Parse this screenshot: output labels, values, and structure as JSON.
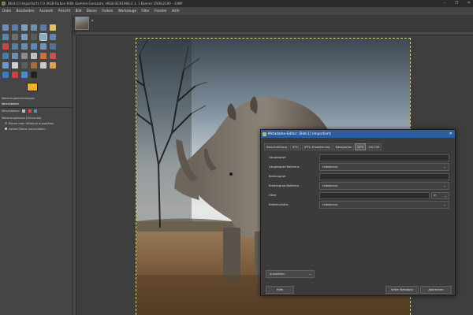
{
  "window": {
    "title": "[Bild-1] (importiert)-7.0 (RGB-Farben 8-Bit Gamma-Ganzzahl, sRGB IEC61966-2.1, 1 Ebene) 1560x2100 – GIMP",
    "controls": [
      "–",
      "❐",
      "✕"
    ]
  },
  "menu": [
    "Datei",
    "Bearbeiten",
    "Auswahl",
    "Ansicht",
    "Bild",
    "Ebene",
    "Farben",
    "Werkzeuge",
    "Filter",
    "Fenster",
    "Hilfe"
  ],
  "toolbox": {
    "foreground_color": "#e8b22e",
    "background_color": "#ffffff",
    "options_title": "Werkzeugeinstellungen",
    "tool_name": "Verschieben",
    "option_move": "Verschieben:",
    "toggle_label": "Werkzeugmodus (Umschalt)",
    "radio1": "Ebene oder Hilfslinie auswählen",
    "radio2": "Aktive Ebene verschieben"
  },
  "image_tab": {
    "close_icon": "✕"
  },
  "dialog": {
    "title": "Metadaten-Editor: [Bild-1] (importiert)",
    "close": "✕",
    "tabs": [
      "Beschreibung",
      "IPTC",
      "IPTC-Erweiterung",
      "Kategorien",
      "GPS",
      "DICOM"
    ],
    "active_tab": "GPS",
    "fields": {
      "laengengrad": "Längengrad",
      "laengengrad_ref": "Längengrad-Referenz",
      "laengengrad_ref_value": "Unbekannt",
      "breitengrad": "Breitengrad",
      "breitengrad_ref": "Breitengrad-Referenz",
      "breitengrad_ref_value": "Unbekannt",
      "hoehe": "Höhe",
      "hoehe_unit": "m",
      "referenzhoehe": "Referenzhöhe",
      "referenzhoehe_value": "Unbekannt"
    },
    "auswaehlen": "Auswählen",
    "help": "Hilfe",
    "write": "Write Metadata",
    "cancel": "Abbrechen"
  }
}
